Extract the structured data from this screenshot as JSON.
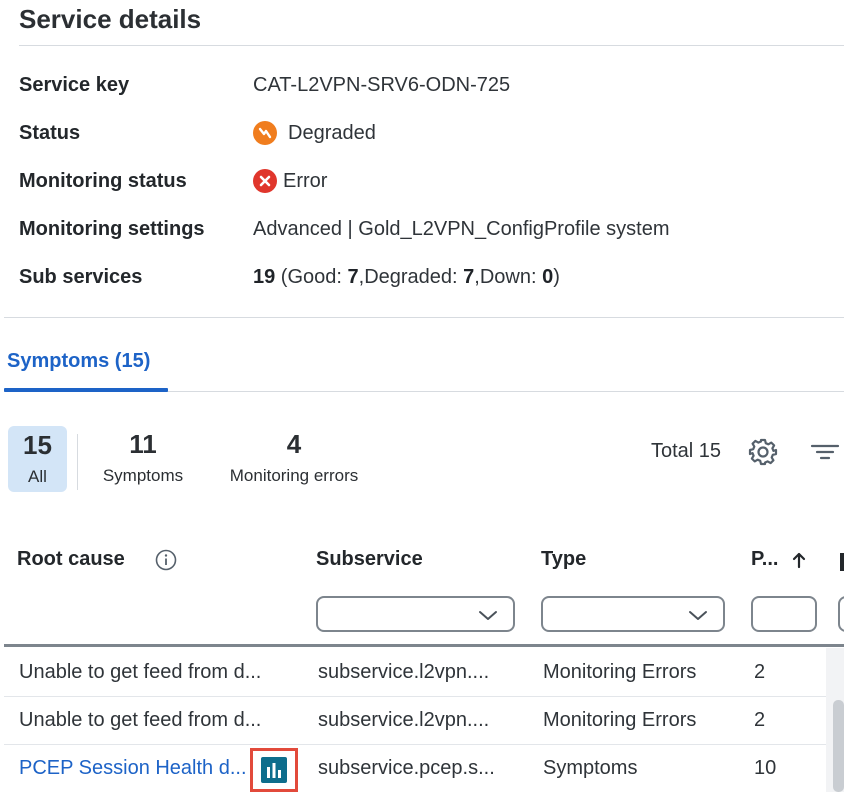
{
  "page_title": "Service details",
  "details": {
    "service_key": {
      "label": "Service key",
      "value": "CAT-L2VPN-SRV6-ODN-725"
    },
    "status": {
      "label": "Status",
      "value": "Degraded",
      "icon": "degraded-icon",
      "color": "#f07d1e"
    },
    "monitoring_status": {
      "label": "Monitoring status",
      "value": "Error",
      "icon": "error-icon",
      "color": "#e0362c"
    },
    "monitoring_settings": {
      "label": "Monitoring settings",
      "value": "Advanced | Gold_L2VPN_ConfigProfile system"
    },
    "sub_services": {
      "label": "Sub services",
      "total": "19",
      "open": " (Good: ",
      "good": "7",
      "degraded_label": ",Degraded: ",
      "degraded": "7",
      "down_label": ",Down: ",
      "down": "0",
      "close": ")"
    }
  },
  "tabs": [
    {
      "label": "Symptoms (15)",
      "active": true
    }
  ],
  "filters": [
    {
      "count": "15",
      "label": "All",
      "selected": true
    },
    {
      "count": "11",
      "label": "Symptoms",
      "selected": false
    },
    {
      "count": "4",
      "label": "Monitoring errors",
      "selected": false
    }
  ],
  "toolbar": {
    "total_text": "Total 15"
  },
  "table": {
    "columns": [
      {
        "label": "Root cause"
      },
      {
        "label": "Subservice"
      },
      {
        "label": "Type"
      },
      {
        "label": "P...",
        "sort": "ascending"
      }
    ],
    "rows": [
      {
        "root_cause": "Unable to get feed from d...",
        "subservice": "subservice.l2vpn....",
        "type": "Monitoring Errors",
        "p": "2"
      },
      {
        "root_cause": "Unable to get feed from d...",
        "subservice": "subservice.l2vpn....",
        "type": "Monitoring Errors",
        "p": "2"
      },
      {
        "root_cause": "PCEP Session Health d...",
        "subservice": "subservice.pcep.s...",
        "type": "Symptoms",
        "p": "10"
      }
    ]
  },
  "colors": {
    "accent": "#1d63c7",
    "selected_bg": "#d3e5f7",
    "highlight": "#e24a3b",
    "chart_icon": "#0d6d8c"
  }
}
